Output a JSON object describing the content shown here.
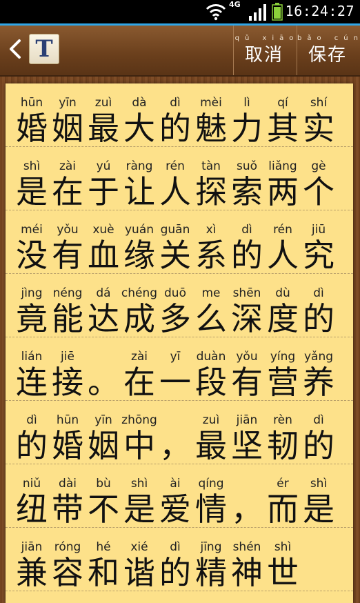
{
  "status_bar": {
    "network": "4G",
    "time": "16:24:27"
  },
  "header": {
    "font_button_label": "T",
    "cancel": {
      "pinyin": "qǔ xiāo",
      "label": "取消"
    },
    "save": {
      "pinyin": "bǎo cún",
      "label": "保存"
    }
  },
  "lines": [
    [
      [
        "hūn",
        "婚"
      ],
      [
        "yīn",
        "姻"
      ],
      [
        "zuì",
        "最"
      ],
      [
        "dà",
        "大"
      ],
      [
        "dì",
        "的"
      ],
      [
        "mèi",
        "魅"
      ],
      [
        "lì",
        "力"
      ],
      [
        "qí",
        "其"
      ],
      [
        "shí",
        "实"
      ]
    ],
    [
      [
        "shì",
        "是"
      ],
      [
        "zài",
        "在"
      ],
      [
        "yú",
        "于"
      ],
      [
        "ràng",
        "让"
      ],
      [
        "rén",
        "人"
      ],
      [
        "tàn",
        "探"
      ],
      [
        "suǒ",
        "索"
      ],
      [
        "liǎng",
        "两"
      ],
      [
        "gè",
        "个"
      ]
    ],
    [
      [
        "méi",
        "没"
      ],
      [
        "yǒu",
        "有"
      ],
      [
        "xuè",
        "血"
      ],
      [
        "yuán",
        "缘"
      ],
      [
        "guān",
        "关"
      ],
      [
        "xì",
        "系"
      ],
      [
        "dì",
        "的"
      ],
      [
        "rén",
        "人"
      ],
      [
        "jiū",
        "究"
      ]
    ],
    [
      [
        "jìng",
        "竟"
      ],
      [
        "néng",
        "能"
      ],
      [
        "dá",
        "达"
      ],
      [
        "chéng",
        "成"
      ],
      [
        "duō",
        "多"
      ],
      [
        "me",
        "么"
      ],
      [
        "shēn",
        "深"
      ],
      [
        "dù",
        "度"
      ],
      [
        "dì",
        "的"
      ]
    ],
    [
      [
        "lián",
        "连"
      ],
      [
        "jiē",
        "接"
      ],
      [
        "",
        "。"
      ],
      [
        "zài",
        "在"
      ],
      [
        "yī",
        "一"
      ],
      [
        "duàn",
        "段"
      ],
      [
        "yǒu",
        "有"
      ],
      [
        "yíng",
        "营"
      ],
      [
        "yǎng",
        "养"
      ]
    ],
    [
      [
        "dì",
        "的"
      ],
      [
        "hūn",
        "婚"
      ],
      [
        "yīn",
        "姻"
      ],
      [
        "zhōng",
        "中"
      ],
      [
        "",
        "，"
      ],
      [
        "zuì",
        "最"
      ],
      [
        "jiān",
        "坚"
      ],
      [
        "rèn",
        "韧"
      ],
      [
        "dì",
        "的"
      ]
    ],
    [
      [
        "niǔ",
        "纽"
      ],
      [
        "dài",
        "带"
      ],
      [
        "bù",
        "不"
      ],
      [
        "shì",
        "是"
      ],
      [
        "ài",
        "爱"
      ],
      [
        "qíng",
        "情"
      ],
      [
        "",
        "，"
      ],
      [
        "ér",
        "而"
      ],
      [
        "shì",
        "是"
      ]
    ],
    [
      [
        "jiān",
        "兼"
      ],
      [
        "róng",
        "容"
      ],
      [
        "hé",
        "和"
      ],
      [
        "xié",
        "谐"
      ],
      [
        "dì",
        "的"
      ],
      [
        "jīng",
        "精"
      ],
      [
        "shén",
        "神"
      ],
      [
        "shì",
        "世"
      ]
    ]
  ]
}
